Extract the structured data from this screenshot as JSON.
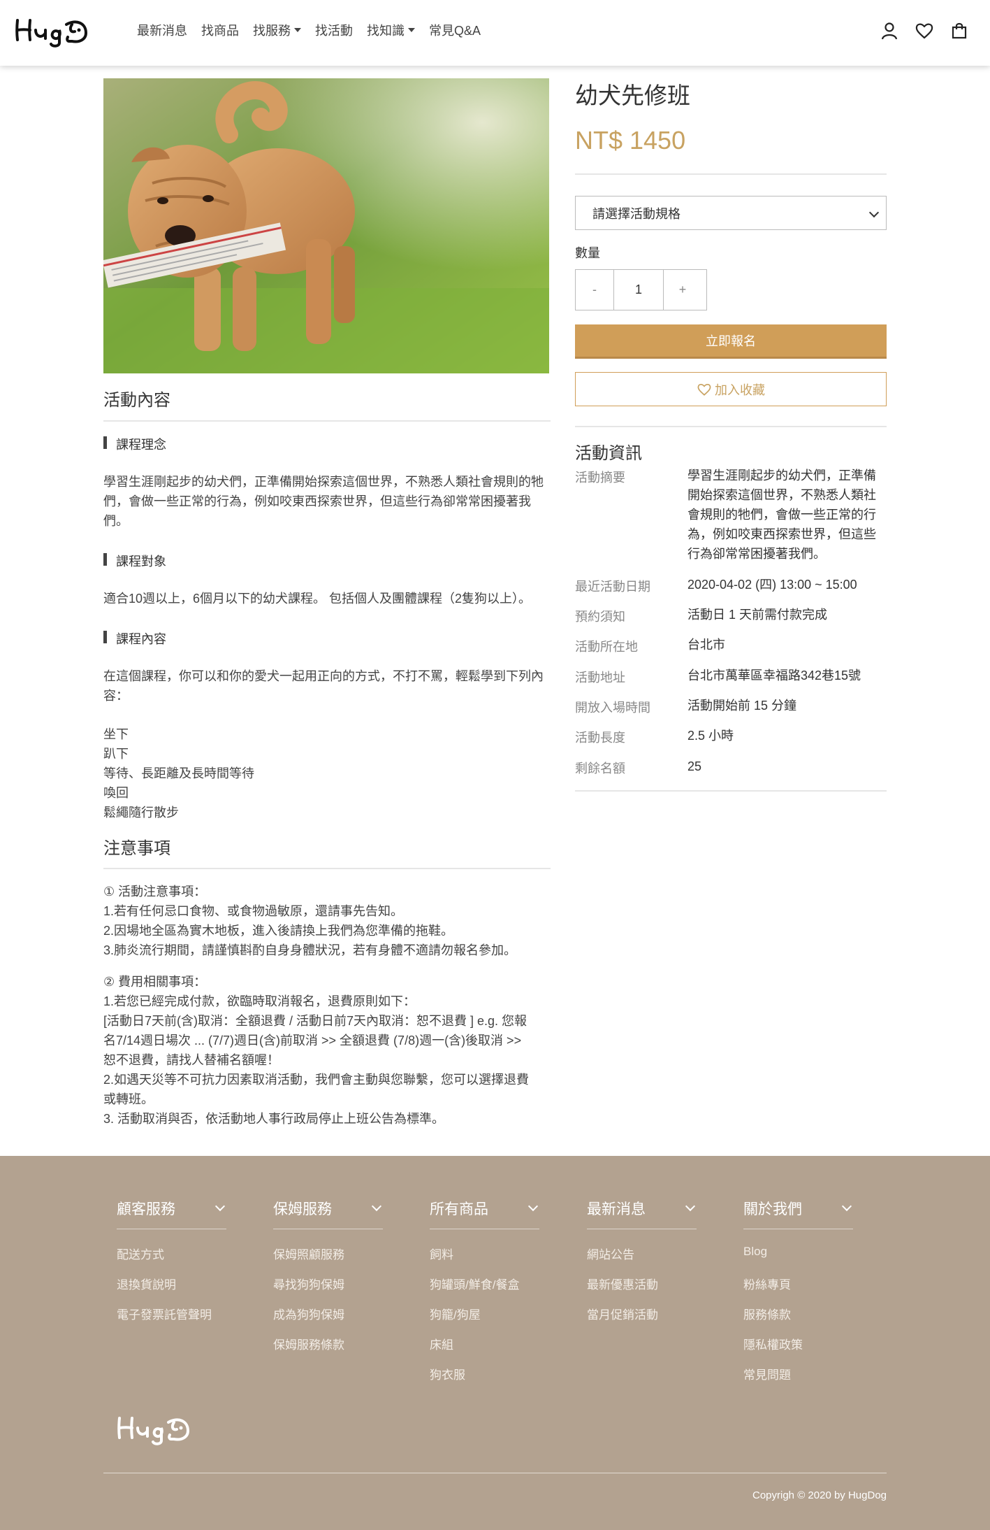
{
  "header": {
    "logo_text": "Hug",
    "nav": [
      {
        "label": "最新消息",
        "dropdown": false
      },
      {
        "label": "找商品",
        "dropdown": false
      },
      {
        "label": "找服務",
        "dropdown": true
      },
      {
        "label": "找活動",
        "dropdown": false
      },
      {
        "label": "找知識",
        "dropdown": true
      },
      {
        "label": "常見Q&A",
        "dropdown": false
      }
    ],
    "icons": [
      "user-icon",
      "heart-icon",
      "shopping-bag-icon"
    ]
  },
  "product": {
    "title": "幼犬先修班",
    "price": "NT$ 1450",
    "select_placeholder": "請選擇活動規格",
    "quantity_label": "數量",
    "quantity_minus": "-",
    "quantity_value": "1",
    "quantity_plus": "+",
    "apply_button": "立即報名",
    "favorite_button": "加入收藏"
  },
  "content": {
    "section_title": "活動內容",
    "concept_head": "課程理念",
    "concept_text": "學習生涯剛起步的幼犬們，正準備開始探索這個世界，不熟悉人類社會規則的牠們，會做一些正常的行為，例如咬東西探索世界，但這些行為卻常常困擾著我們。",
    "target_head": "課程對象",
    "target_text": "適合10週以上，6個月以下的幼犬課程。 包括個人及團體課程（2隻狗以上）。",
    "course_head": "課程內容",
    "course_text": "在這個課程，你可以和你的愛犬一起用正向的方式，不打不罵，輕鬆學到下列內容：",
    "course_items": [
      "坐下",
      "趴下",
      "等待、長距離及長時間等待",
      "喚回",
      "鬆繩隨行散步"
    ]
  },
  "notes": {
    "title": "注意事項",
    "block1": [
      "① 活動注意事項：",
      "1.若有任何忌口食物、或食物過敏原，還請事先告知。",
      "2.因場地全區為實木地板，進入後請換上我們為您準備的拖鞋。",
      "3.肺炎流行期間，請謹慎斟酌自身身體狀況，若有身體不適請勿報名參加。"
    ],
    "block2": [
      "② 費用相關事項：",
      "1.若您已經完成付款，欲臨時取消報名，退費原則如下：",
      "[活動日7天前(含)取消：全額退費 / 活動日前7天內取消：恕不退費 ] e.g. 您報",
      "名7/14週日場次 ... (7/7)週日(含)前取消 >> 全額退費 (7/8)週一(含)後取消 >>",
      "恕不退費，請找人替補名額喔！",
      "2.如遇天災等不可抗力因素取消活動，我們會主動與您聯繫，您可以選擇退費",
      "或轉班。",
      "3. 活動取消與否，依活動地人事行政局停止上班公告為標準。"
    ]
  },
  "info": {
    "title": "活動資訊",
    "summary_key": "活動摘要",
    "summary_lines": [
      "學習生涯剛起步的幼犬們，正準備",
      "開始探索這個世界，不熟悉人類社",
      "會規則的牠們，會做一些正常的行",
      "為，例如咬東西探索世界，但這些",
      "行為卻常常困擾著我們。"
    ],
    "rows": [
      {
        "key": "最近活動日期",
        "value": "2020-04-02 (四) 13:00 ~ 15:00"
      },
      {
        "key": "預約須知",
        "value": "活動日 1 天前需付款完成"
      },
      {
        "key": "活動所在地",
        "value": "台北市"
      },
      {
        "key": "活動地址",
        "value": "台北市萬華區幸福路342巷15號"
      },
      {
        "key": "開放入場時間",
        "value": "活動開始前 15 分鐘"
      },
      {
        "key": "活動長度",
        "value": "2.5 小時"
      },
      {
        "key": "剩餘名額",
        "value": "25"
      }
    ]
  },
  "footer": {
    "columns": [
      {
        "title": "顧客服務",
        "links": [
          "配送方式",
          "退換貨說明",
          "電子發票託管聲明"
        ]
      },
      {
        "title": "保姆服務",
        "links": [
          "保姆照顧服務",
          "尋找狗狗保姆",
          "成為狗狗保姆",
          "保姆服務條款"
        ]
      },
      {
        "title": "所有商品",
        "links": [
          "飼料",
          "狗罐頭/鮮食/餐盒",
          "狗籠/狗屋",
          "床組",
          "狗衣服"
        ]
      },
      {
        "title": "最新消息",
        "links": [
          "網站公告",
          "最新優惠活動",
          "當月促銷活動"
        ]
      },
      {
        "title": "關於我們",
        "links": [
          "Blog",
          "粉絲專頁",
          "服務條款",
          "隱私權政策",
          "常見問題"
        ]
      }
    ],
    "logo_text": "Hug",
    "copyright": "Copyrigh © 2020 by HugDog"
  },
  "colors": {
    "accent": "#d09e58",
    "price": "#c8a261",
    "footer_bg": "#b3a290"
  }
}
